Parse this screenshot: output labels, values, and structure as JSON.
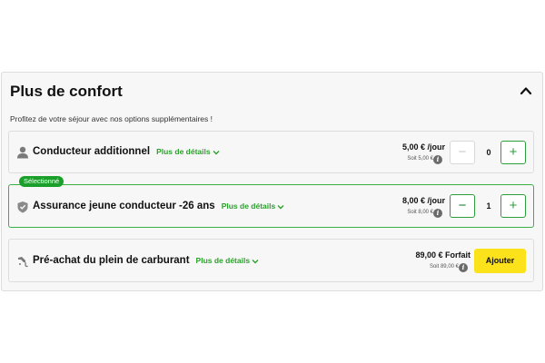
{
  "section": {
    "title": "Plus de confort",
    "subtitle": "Profitez de votre séjour avec nos options supplémentaires !"
  },
  "options": [
    {
      "title": "Conducteur additionnel",
      "details_label": "Plus de détails",
      "price": "5,00 € /jour",
      "price_sub": "Soit 5,00 €",
      "quantity": "0",
      "minus": "−",
      "plus": "+",
      "icon": "person-icon"
    },
    {
      "badge": "Sélectionné",
      "title": "Assurance jeune conducteur -26 ans",
      "details_label": "Plus de détails",
      "price": "8,00 € /jour",
      "price_sub": "Soit 8,00 €",
      "quantity": "1",
      "minus": "−",
      "plus": "+",
      "icon": "shield-icon"
    },
    {
      "title": "Pré-achat du plein de carburant",
      "details_label": "Plus de détails",
      "price": "89,00 € Forfait",
      "price_sub": "Soit 89,00 €",
      "button_label": "Ajouter",
      "icon": "fuel-nozzle-icon"
    }
  ],
  "colors": {
    "accent_green": "#2ca02c",
    "badge_green": "#1a9f2a",
    "button_yellow": "#fbe21a"
  }
}
